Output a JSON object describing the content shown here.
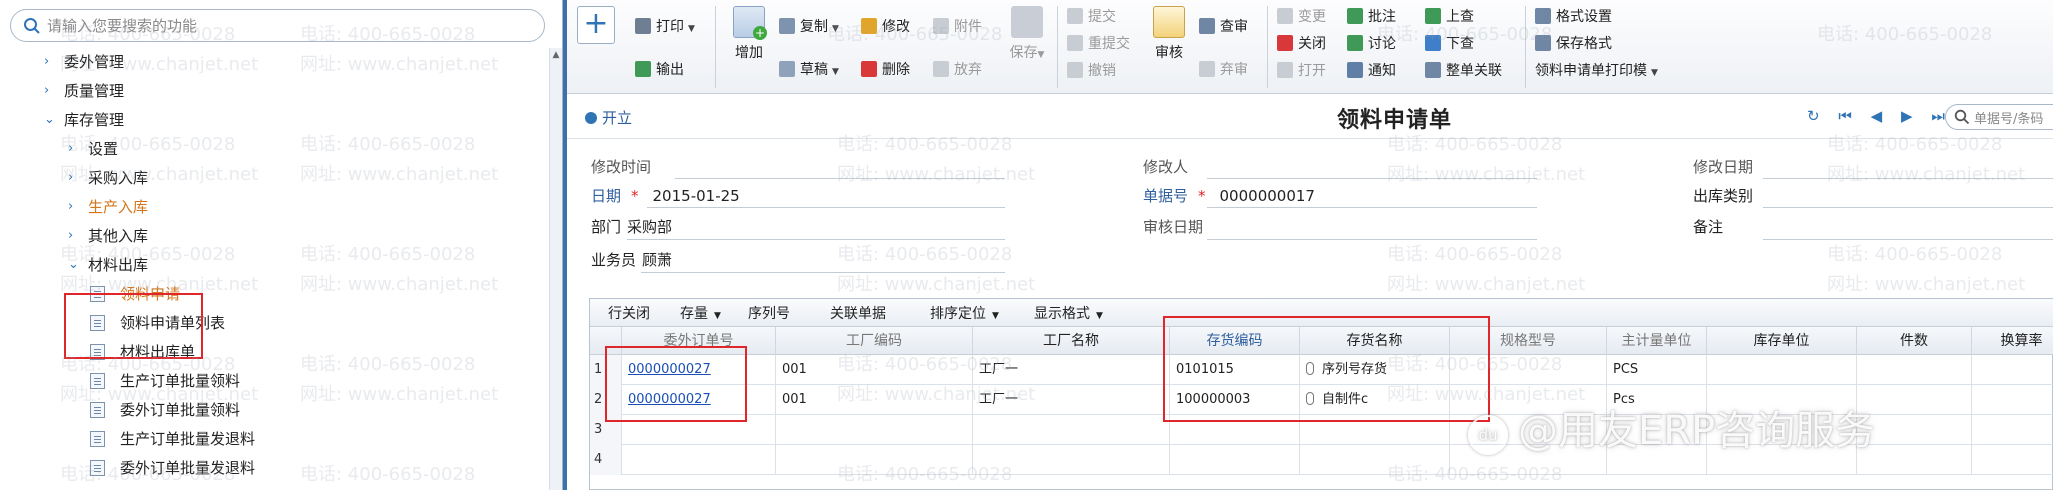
{
  "search": {
    "placeholder": "请输入您要搜索的功能"
  },
  "tree": {
    "items": [
      {
        "label": "委外管理",
        "arrow": "›"
      },
      {
        "label": "质量管理",
        "arrow": "›"
      },
      {
        "label": "库存管理",
        "arrow": "⌄"
      },
      {
        "label": "设置",
        "arrow": "›"
      },
      {
        "label": "采购入库",
        "arrow": "›"
      },
      {
        "label": "生产入库",
        "arrow": "›"
      },
      {
        "label": "其他入库",
        "arrow": "›"
      },
      {
        "label": "材料出库",
        "arrow": "⌄"
      },
      {
        "label": "领料申请"
      },
      {
        "label": "领料申请单列表"
      },
      {
        "label": "材料出库单"
      },
      {
        "label": "生产订单批量领料"
      },
      {
        "label": "委外订单批量领料"
      },
      {
        "label": "生产订单批量发退料"
      },
      {
        "label": "委外订单批量发退料"
      }
    ]
  },
  "toolbar": {
    "add_symbol": "+",
    "print": "打印",
    "export": "输出",
    "add": "增加",
    "copy": "复制",
    "draft": "草稿",
    "modify": "修改",
    "delete": "删除",
    "attach": "附件",
    "abandon": "放弃",
    "save": "保存",
    "submit": "提交",
    "resubmit": "重提交",
    "revoke": "撤销",
    "audit": "审核",
    "review": "查审",
    "discard": "弃审",
    "change": "变更",
    "close": "关闭",
    "open": "打开",
    "annotate": "批注",
    "discuss": "讨论",
    "notify": "通知",
    "prev": "上查",
    "next": "下查",
    "link": "整单关联",
    "format_setting": "格式设置",
    "save_format": "保存格式",
    "print_template": "领料申请单打印模"
  },
  "titlebar": {
    "open": "开立",
    "title": "领料申请单",
    "nav_icons": [
      "↻",
      "⏮",
      "◀",
      "▶",
      "⏭"
    ],
    "bill_search_placeholder": "单据号/条码"
  },
  "form": {
    "modify_time_label": "修改时间",
    "modifier_label": "修改人",
    "modify_date_label": "修改日期",
    "date_label": "日期",
    "date_value": "2015-01-25",
    "bill_no_label": "单据号",
    "bill_no_value": "0000000017",
    "out_type_label": "出库类别",
    "dept_label": "部门",
    "dept_value": "采购部",
    "audit_date_label": "审核日期",
    "remark_label": "备注",
    "clerk_label": "业务员",
    "clerk_value": "顾萧",
    "required_mark": "*"
  },
  "grid": {
    "tools": [
      "行关闭",
      "存量",
      "序列号",
      "关联单据",
      "排序定位",
      "显示格式"
    ],
    "columns": [
      "",
      "委外订单号",
      "工厂编码",
      "工厂名称",
      "存货编码",
      "存货名称",
      "规格型号",
      "主计量单位",
      "库存单位",
      "件数",
      "换算率"
    ],
    "rows": [
      {
        "num": "1",
        "order": "0000000027",
        "factory_code": "001",
        "factory_name": "工厂一",
        "inv_code": "0101015",
        "inv_name": "序列号存货",
        "spec": "",
        "unit": "PCS"
      },
      {
        "num": "2",
        "order": "0000000027",
        "factory_code": "001",
        "factory_name": "工厂一",
        "inv_code": "100000003",
        "inv_name": "自制件c",
        "spec": "",
        "unit": "Pcs"
      },
      {
        "num": "3"
      },
      {
        "num": "4"
      }
    ]
  },
  "watermark": {
    "phone": "电话: 400-665-0028",
    "site": "网址: www.chanjet.net"
  },
  "brand": {
    "logo_text": "du",
    "text": "@用友ERP咨询服务"
  },
  "colors": {
    "accent": "#2f74b5",
    "highlight": "#e0262b",
    "link": "#1a4fb8",
    "orange": "#d4771c"
  }
}
